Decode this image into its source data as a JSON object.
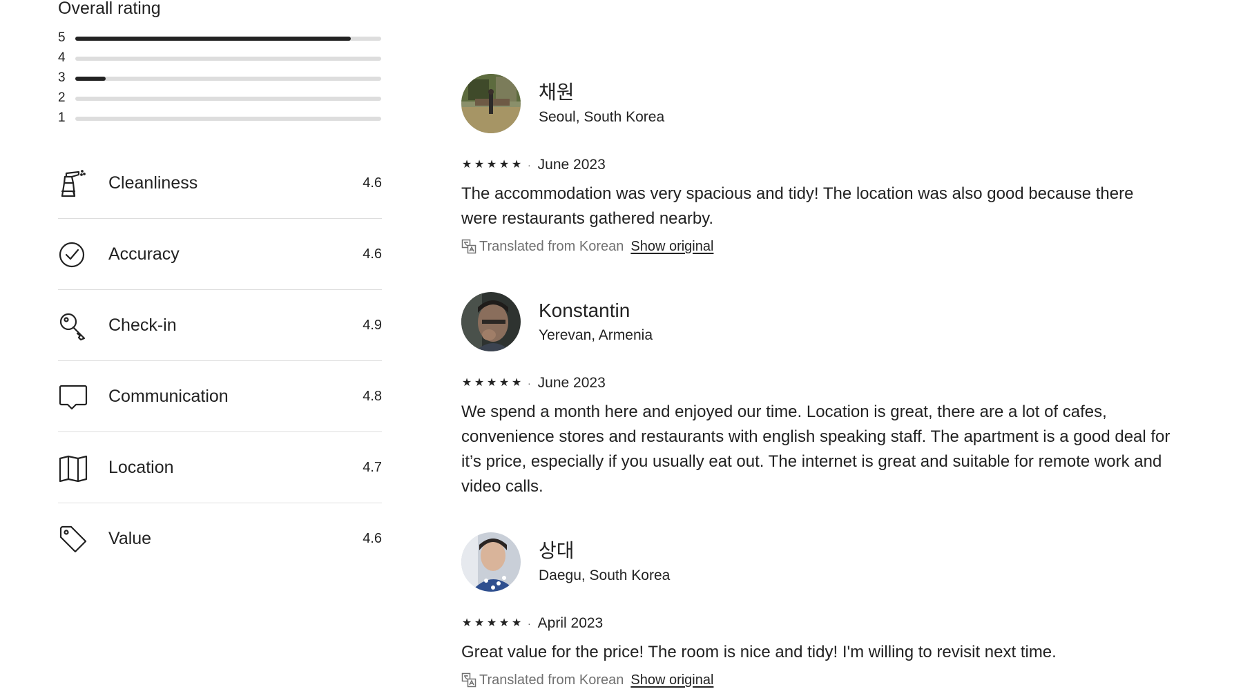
{
  "overall": {
    "title": "Overall rating",
    "distribution": [
      {
        "stars": "5",
        "fraction": 0.9
      },
      {
        "stars": "4",
        "fraction": 0.0
      },
      {
        "stars": "3",
        "fraction": 0.1
      },
      {
        "stars": "2",
        "fraction": 0.0
      },
      {
        "stars": "1",
        "fraction": 0.0
      }
    ]
  },
  "categories": [
    {
      "label": "Cleanliness",
      "score": "4.6",
      "icon": "spray-bottle-icon"
    },
    {
      "label": "Accuracy",
      "score": "4.6",
      "icon": "check-circle-icon"
    },
    {
      "label": "Check-in",
      "score": "4.9",
      "icon": "key-icon"
    },
    {
      "label": "Communication",
      "score": "4.8",
      "icon": "chat-bubble-icon"
    },
    {
      "label": "Location",
      "score": "4.7",
      "icon": "map-icon"
    },
    {
      "label": "Value",
      "score": "4.6",
      "icon": "tag-icon"
    }
  ],
  "reviews": [
    {
      "name": "채원",
      "location": "Seoul, South Korea",
      "rating": 5,
      "date": "June 2023",
      "text": "The accommodation was very spacious and tidy! The location was also good because there were restaurants gathered nearby.",
      "translated_label": "Translated from Korean",
      "show_original_label": "Show original"
    },
    {
      "name": "Konstantin",
      "location": "Yerevan, Armenia",
      "rating": 5,
      "date": "June 2023",
      "text": "We spend a month here and enjoyed our time. Location is great, there are a lot of cafes, convenience stores and restaurants with english speaking staff. The apartment is a good deal for it’s price, especially if you usually eat out. The internet is great and suitable for remote work and video calls."
    },
    {
      "name": "상대",
      "location": "Daegu, South Korea",
      "rating": 5,
      "date": "April 2023",
      "text": "Great value for the price! The room is nice and tidy! I'm willing to revisit next time.",
      "translated_label": "Translated from Korean",
      "show_original_label": "Show original"
    }
  ],
  "colors": {
    "text": "#222222",
    "muted": "#717171",
    "track": "#dddddd",
    "divider": "#dddddd"
  }
}
